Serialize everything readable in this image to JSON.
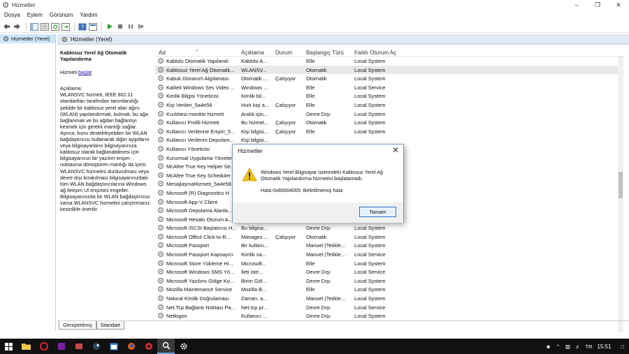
{
  "window": {
    "title": "Hizmetler"
  },
  "menu": [
    "Dosya",
    "Eylem",
    "Görünüm",
    "Yardım"
  ],
  "tree": {
    "root_label": "Hizmetler (Yerel)"
  },
  "content": {
    "header_label": "Hizmetler (Yerel)"
  },
  "description": {
    "title": "Kablosuz Yerel Ağ Otomatik Yapılandırma",
    "action_prefix": "Hizmeti",
    "action_link": "başlat",
    "label": "Açıklama:",
    "text": "WLANSVC hizmeti, IEEE 802.11 standartları tarafından tanımlandığı şekilde bir kablosuz yerel alan ağını (WLAN) yapılandırmak, bulmak, bu ağa bağlanmak ve bu ağdan bağlantıyı kesmek için gerekli mantığı sağlar. Ayrıca, bunu destekleyebilen bir WLAN bağdaştırıcısı kullanarak diğer aygıtların veya bilgisayarların bilgisayarınıza kablosuz olarak bağlanabilmesi için bilgisayarınızı bir yazılım erişim noktasına dönüştüren mantığı da içerir. WLANSVC hizmetini durdurulması veya devre dışı bırakılması bilgisayarınızdaki tüm WLAN bağdaştırıcılarına Windows ağ iletişim UI erişimini engeller. Bilgisayarınızda bir WLAN bağdaştırıcısı varsa WLANSVC hizmetini çalıştırmanız kesinlikle önerilir."
  },
  "columns": {
    "name": "Ad",
    "desc": "Açıklama",
    "state": "Durum",
    "start": "Başlangıç Türü",
    "logon": "Farklı Oturum Aç"
  },
  "rows": [
    {
      "name": "Kablolu Otomatik Yapılandı",
      "desc": "Kablolu A...",
      "state": "",
      "start": "Elle",
      "logon": "Local System"
    },
    {
      "name": "Kablosuz Yerel Ağ Otomatik...",
      "desc": "WLANSV...",
      "state": "",
      "start": "Otomatik",
      "logon": "Local System"
    },
    {
      "name": "Kabuk Donanım Algılaması",
      "desc": "Otomatik ...",
      "state": "Çalışıyor",
      "start": "Otomatik",
      "logon": "Local System"
    },
    {
      "name": "Kaliteli Windows Ses Video ...",
      "desc": "Windows ...",
      "state": "",
      "start": "Elle",
      "logon": "Local Service"
    },
    {
      "name": "Kimlik Bilgisi Yöneticisi",
      "desc": "Kimlik bil...",
      "state": "",
      "start": "Elle",
      "logon": "Local System"
    },
    {
      "name": "Kişi Verileri_5a4e58",
      "desc": "Hızlı kişi a...",
      "state": "Çalışıyor",
      "start": "Elle",
      "logon": "Local System"
    },
    {
      "name": "Kızılötesi monitör hizmeti",
      "desc": "Aralık için...",
      "state": "",
      "start": "Devre Dışı",
      "logon": "Local System"
    },
    {
      "name": "Kullanıcı Profili Hizmeti",
      "desc": "Bu hizmet...",
      "state": "Çalışıyor",
      "start": "Otomatik",
      "logon": "Local System"
    },
    {
      "name": "Kullanıcı Verilerine Erişim_5...",
      "desc": "Kişi bilgisi...",
      "state": "Çalışıyor",
      "start": "Elle",
      "logon": "Local System"
    },
    {
      "name": "Kullanıcı Verilerini Depolam...",
      "desc": "Kişi bilgisi...",
      "state": "",
      "start": "",
      "logon": ""
    },
    {
      "name": "Kullanıcı Yöneticisi",
      "desc": "",
      "state": "",
      "start": "",
      "logon": ""
    },
    {
      "name": "Kurumsal Uygulama Yönetimi",
      "desc": "",
      "state": "",
      "start": "",
      "logon": ""
    },
    {
      "name": "McAfee True Key Helper Se...",
      "desc": "",
      "state": "",
      "start": "",
      "logon": ""
    },
    {
      "name": "McAfee True Key Scheduler",
      "desc": "",
      "state": "",
      "start": "",
      "logon": ""
    },
    {
      "name": "MesajlaşmaHizmeti_5a4e58",
      "desc": "",
      "state": "",
      "start": "",
      "logon": ""
    },
    {
      "name": "Microsoft (R) Diagnostics H",
      "desc": "",
      "state": "",
      "start": "",
      "logon": ""
    },
    {
      "name": "Microsoft App-V Client",
      "desc": "",
      "state": "",
      "start": "",
      "logon": ""
    },
    {
      "name": "Microsoft Depolama Alanla...",
      "desc": "",
      "state": "",
      "start": "",
      "logon": ""
    },
    {
      "name": "Microsoft Hesabı Oturum A...",
      "desc": "",
      "state": "",
      "start": "",
      "logon": ""
    },
    {
      "name": "Microsoft iSCSI Başlatıcısı H...",
      "desc": "Bu bilgisa...",
      "state": "",
      "start": "Devre Dışı",
      "logon": "Local System"
    },
    {
      "name": "Microsoft Office Click-to-R...",
      "desc": "Manages ...",
      "state": "Çalışıyor",
      "start": "Otomatik",
      "logon": "Local System"
    },
    {
      "name": "Microsoft Passport",
      "desc": "Bir kullanı...",
      "state": "",
      "start": "Manuel (Tetikle...",
      "logon": "Local System"
    },
    {
      "name": "Microsoft Passport Kapsayıcı",
      "desc": "Kimlik sa...",
      "state": "",
      "start": "Manuel (Tetikle...",
      "logon": "Local Service"
    },
    {
      "name": "Microsoft Store Yükleme Hi...",
      "desc": "Microsoft...",
      "state": "",
      "start": "Elle",
      "logon": "Local System"
    },
    {
      "name": "Microsoft Windows SMS Yö...",
      "desc": "İleti iste...",
      "state": "",
      "start": "Devre Dışı",
      "logon": "Local Service"
    },
    {
      "name": "Microsoft Yazılımı Gölge Ko...",
      "desc": "Birim Göl...",
      "state": "",
      "start": "Devre Dışı",
      "logon": "Local System"
    },
    {
      "name": "Mozilla Maintenance Service",
      "desc": "Mozilla B...",
      "state": "",
      "start": "Elle",
      "logon": "Local System"
    },
    {
      "name": "Natural Kimlik Doğrulaması",
      "desc": "Zaman, a...",
      "state": "",
      "start": "Manuel (Tetikle...",
      "logon": "Local System"
    },
    {
      "name": "Net.Tcp Bağlantı Noktası Pa...",
      "desc": "Net.tcp pr...",
      "state": "",
      "start": "Devre Dışı",
      "logon": "Local Service"
    },
    {
      "name": "Netlogon",
      "desc": "Kullanıcı ...",
      "state": "",
      "start": "Devre Dışı",
      "logon": "Local System"
    }
  ],
  "tabs": [
    "Genişletilmiş",
    "Standart"
  ],
  "dialog": {
    "title": "Hizmetler",
    "message": "Windows Yerel Bilgisayar üzerindeki Kablosuz Yerel Ağ Otomatik Yapılandırma hizmetini başlatamadı.",
    "error": "Hata 0x80004005: Belirtilmemiş hata",
    "ok_label": "Tamam"
  },
  "taskbar": {
    "tray_lang": "TR",
    "clock": "15:51"
  },
  "colors": {
    "accent": "#2a73c5",
    "header_bg": "#dfe7f1",
    "taskbar": "#111111"
  }
}
